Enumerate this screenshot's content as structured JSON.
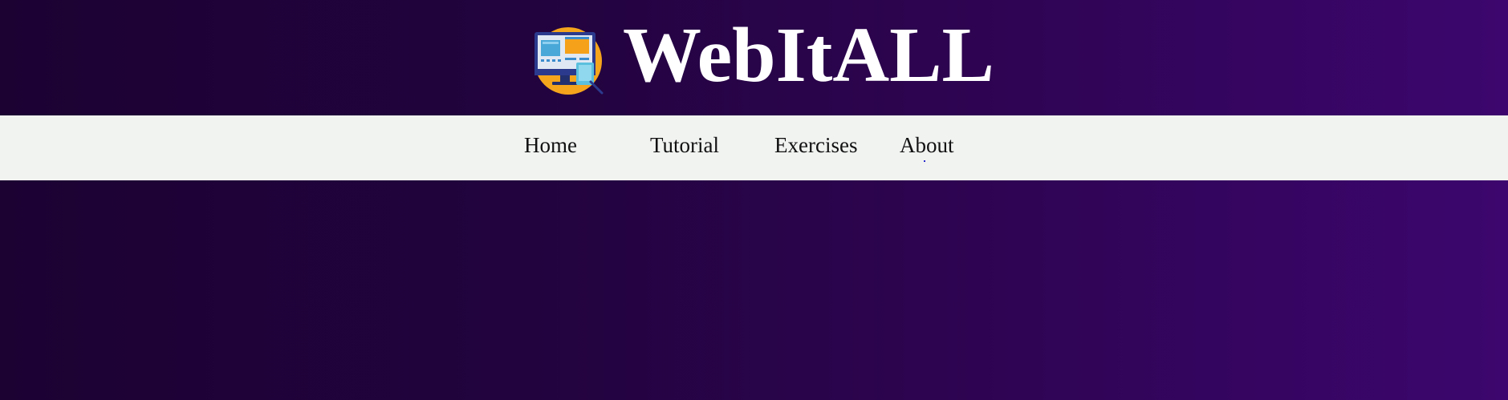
{
  "header": {
    "logo_icon": "computer-monitor-icon",
    "title": "WebItALL"
  },
  "nav": {
    "items": [
      {
        "label": "Home"
      },
      {
        "label": "Tutorial"
      },
      {
        "label": "Exercises"
      },
      {
        "label": "About"
      }
    ]
  },
  "colors": {
    "background_start": "#1c0233",
    "background_end": "#3c066e",
    "navbar": "#f1f3f1",
    "title": "#ffffff",
    "logo_circle": "#f4a51c"
  }
}
